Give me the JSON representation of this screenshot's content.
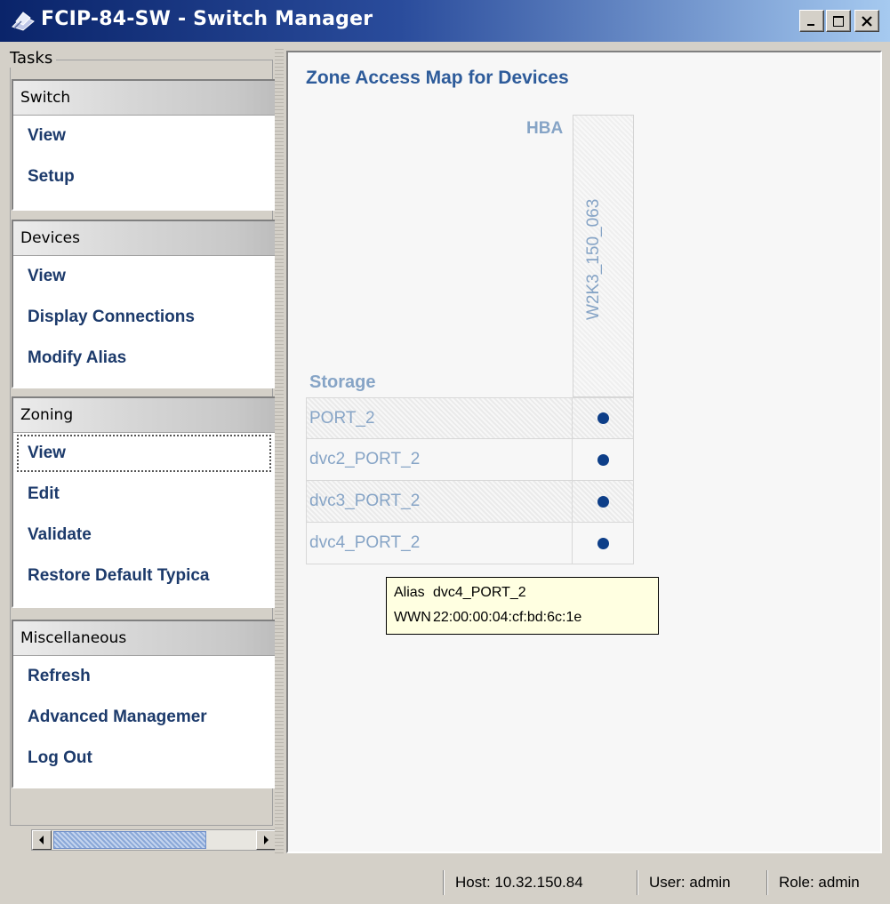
{
  "window": {
    "title": "FCIP-84-SW - Switch Manager",
    "controls": {
      "minimize": "_",
      "maximize": "□",
      "close": "X"
    }
  },
  "sidebar": {
    "legend": "Tasks",
    "groups": [
      {
        "title": "Switch",
        "items": [
          {
            "label": "View"
          },
          {
            "label": "Setup"
          }
        ]
      },
      {
        "title": "Devices",
        "items": [
          {
            "label": "View"
          },
          {
            "label": "Display Connections"
          },
          {
            "label": "Modify Alias"
          }
        ]
      },
      {
        "title": "Zoning",
        "items": [
          {
            "label": "View",
            "selected": true
          },
          {
            "label": "Edit"
          },
          {
            "label": "Validate"
          },
          {
            "label": "Restore Default Typica"
          }
        ]
      },
      {
        "title": "Miscellaneous",
        "items": [
          {
            "label": "Refresh"
          },
          {
            "label": "Advanced Managemer"
          },
          {
            "label": "Log Out"
          }
        ]
      }
    ]
  },
  "main": {
    "title": "Zone Access Map for Devices",
    "hba_label": "HBA",
    "storage_label": "Storage",
    "column_header": "W2K3_150_063",
    "rows": [
      {
        "label": "PORT_2",
        "zoned": true
      },
      {
        "label": "dvc2_PORT_2",
        "zoned": true
      },
      {
        "label": "dvc3_PORT_2",
        "zoned": true
      },
      {
        "label": "dvc4_PORT_2",
        "zoned": true
      }
    ],
    "tooltip": {
      "alias_key": "Alias",
      "alias_value": "dvc4_PORT_2",
      "wwn_key": "WWN",
      "wwn_value": "22:00:00:04:cf:bd:6c:1e"
    }
  },
  "status": {
    "host": "Host: 10.32.150.84",
    "user": "User: admin",
    "role": "Role: admin"
  },
  "colors": {
    "title_bar": "#0a246a",
    "task_link": "#1c3a6b",
    "heading": "#2d5b9a",
    "grid_label": "#86a4c6",
    "zone_dot": "#0d3e88",
    "tooltip_bg": "#ffffe1"
  }
}
